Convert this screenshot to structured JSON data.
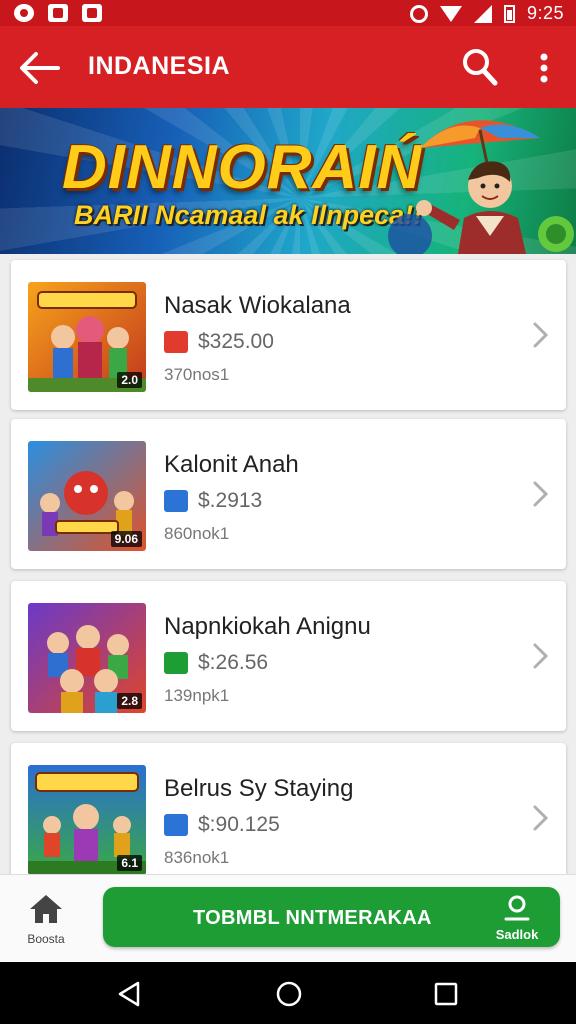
{
  "status_bar": {
    "time": "9:25",
    "left_icons": [
      "close-circle-icon",
      "notification-icon",
      "check-icon"
    ],
    "right_icons": [
      "alarm-icon",
      "wifi-icon",
      "signal-icon",
      "battery-icon"
    ]
  },
  "app_bar": {
    "title": "INDANESIA",
    "background": "#d62023",
    "icons": [
      "back-arrow-icon",
      "search-icon",
      "more-vert-icon"
    ]
  },
  "banner": {
    "title": "DINNORAIŃ",
    "subtitle": "BARII Ncamaal ak Ilnpeca!!"
  },
  "items": [
    {
      "title": "Nasak Wiokalana",
      "price": "$325.00",
      "meta": "370nos1",
      "badge": "2.0",
      "price_icon_color": "#e23b2e"
    },
    {
      "title": "Kalonit Anah",
      "price": "$.2913",
      "meta": "860nok1",
      "badge": "9.06",
      "price_icon_color": "#2b74d6"
    },
    {
      "title": "Napnkiokah Anignu",
      "price": "$:26.56",
      "meta": "139npk1",
      "badge": "2.8",
      "price_icon_color": "#1e9d35"
    },
    {
      "title": "Belrus Sy Staying",
      "price": "$:90.125",
      "meta": "836nok1",
      "badge": "6.1",
      "price_icon_color": "#2b74d6"
    }
  ],
  "bottom_bar": {
    "home_label": "Boosta",
    "cta_label": "TOBMBL NNTMERAKAA",
    "cta_side_label": "Sadlok",
    "cta_color": "#1e9d35"
  },
  "nav_bar": {
    "icons": [
      "nav-back-icon",
      "nav-home-icon",
      "nav-recent-icon"
    ]
  }
}
